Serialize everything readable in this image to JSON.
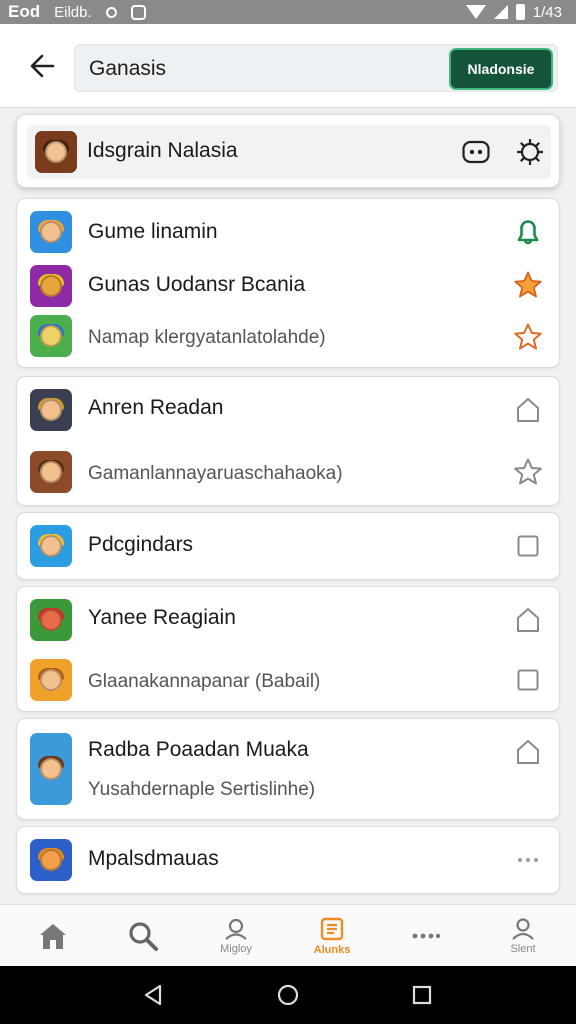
{
  "status_bar": {
    "carrier": "Eod",
    "app_label": "Eildb.",
    "time": "1/43"
  },
  "header": {
    "search_value": "Ganasis",
    "action_label": "Nladonsie"
  },
  "featured": {
    "title": "Idsgrain Nalasia",
    "icons": [
      "gamepad-icon",
      "settings-gear-icon"
    ]
  },
  "cards": [
    {
      "rows": [
        {
          "title": "Gume linamin",
          "icon": "app-icon-blue-character",
          "action": "bell-icon",
          "action_color": "#1e8a4c"
        },
        {
          "title": "Gunas Uodansr Bcania",
          "icon": "app-icon-purple-game",
          "action": "star-filled-icon",
          "action_color": "#f07a1e"
        },
        {
          "subtitle": "Namap klergyatanlatolahde)",
          "icon": "app-icon-green-game",
          "action": "star-outline-icon",
          "action_color": "#e06a2a"
        }
      ]
    },
    {
      "rows": [
        {
          "title": "Anren Readan",
          "icon": "app-icon-knight",
          "action": "house-outline-icon"
        },
        {
          "subtitle": "Gamanlannayaruaschahaoka)",
          "icon": "app-icon-hero",
          "action": "star-outline-icon",
          "action_color": "#888888"
        }
      ]
    },
    {
      "rows": [
        {
          "title": "Pdcgindars",
          "icon": "app-icon-blue-hero",
          "action": "checkbox-icon"
        }
      ]
    },
    {
      "rows": [
        {
          "title": "Yanee Reagiain",
          "icon": "app-icon-red-monster",
          "action": "house-outline-icon"
        },
        {
          "subtitle": "Glaanakannapanar (Babail)",
          "icon": "app-icon-orange-hero",
          "action": "checkbox-icon"
        }
      ]
    },
    {
      "rows": [
        {
          "title": "Radba Poaadan Muaka",
          "subtitle": "Yusahdernaple Sertislinhe)",
          "icon": "app-icon-wizard",
          "action": "house-outline-icon"
        }
      ]
    },
    {
      "rows": [
        {
          "title": "Mpalsdmauas",
          "icon": "app-icon-tiger",
          "action": "more-dots-icon"
        }
      ]
    }
  ],
  "bottom_nav": [
    {
      "label": "",
      "icon": "home-icon"
    },
    {
      "label": "",
      "icon": "search-icon"
    },
    {
      "label": "Migloy",
      "icon": "profile-icon"
    },
    {
      "label": "Alunks",
      "icon": "document-icon",
      "active": true
    },
    {
      "label": "",
      "icon": "more-dots-icon"
    },
    {
      "label": "Slent",
      "icon": "user-icon"
    }
  ],
  "colors": {
    "accent_orange": "#f08a24",
    "action_green": "#14543a",
    "bell_green": "#1e8a4c"
  }
}
